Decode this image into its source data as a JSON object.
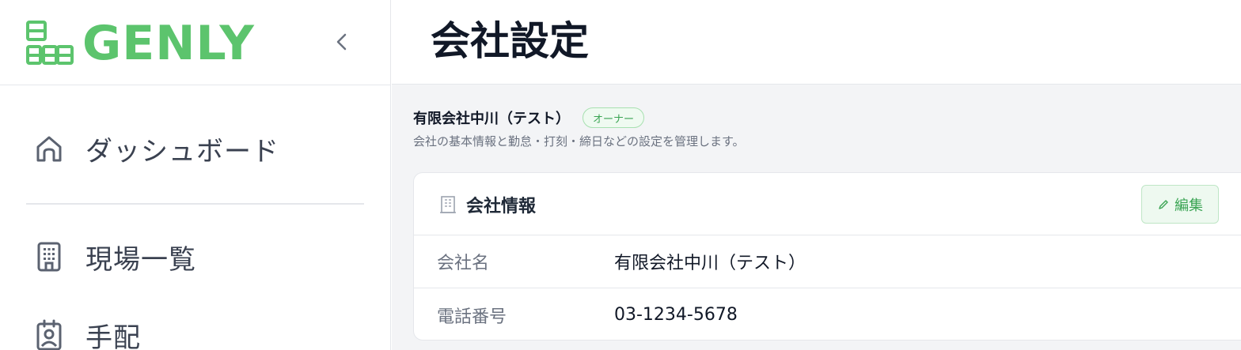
{
  "brand": {
    "name": "GENLY",
    "color": "#5cc46d"
  },
  "sidebar": {
    "items": [
      {
        "label": "ダッシュボード",
        "icon": "home-icon"
      },
      {
        "label": "現場一覧",
        "icon": "building-icon"
      },
      {
        "label": "手配",
        "icon": "badge-icon"
      }
    ]
  },
  "header": {
    "title": "会社設定"
  },
  "company": {
    "name": "有限会社中川（テスト）",
    "role_badge": "オーナー",
    "description": "会社の基本情報と勤怠・打刻・締日などの設定を管理します。"
  },
  "card": {
    "title": "会社情報",
    "edit_label": "編集",
    "rows": [
      {
        "key": "会社名",
        "value": "有限会社中川（テスト）"
      },
      {
        "key": "電話番号",
        "value": "03-1234-5678"
      }
    ]
  }
}
